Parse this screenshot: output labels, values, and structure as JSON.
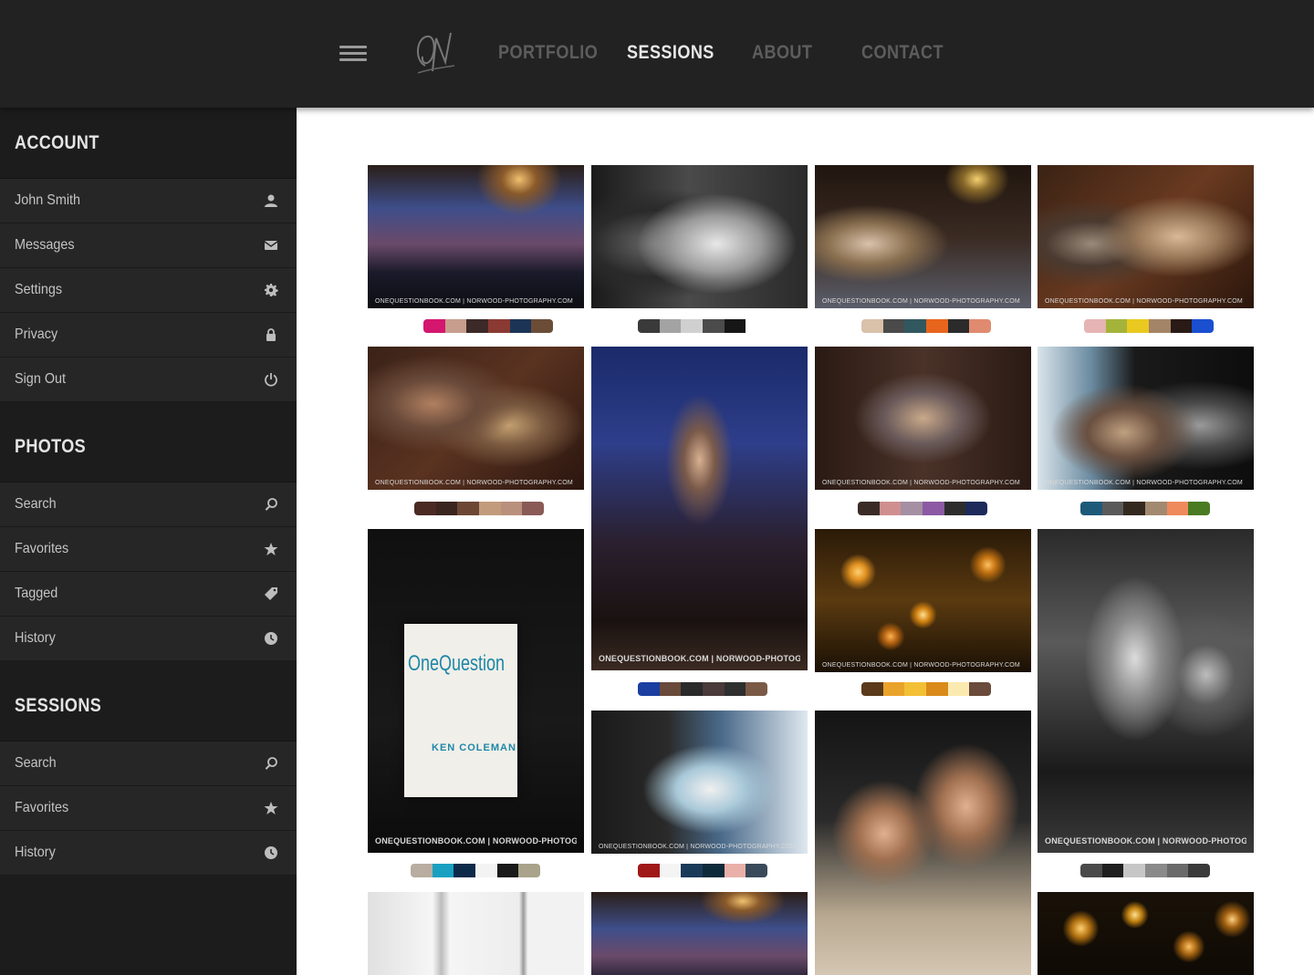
{
  "nav": {
    "logo_text": "ON",
    "items": [
      "PORTFOLIO",
      "SESSIONS",
      "ABOUT",
      "CONTACT"
    ],
    "active": "SESSIONS"
  },
  "sidebar": {
    "account": {
      "title": "ACCOUNT",
      "items": [
        {
          "label": "John Smith",
          "icon": "user-icon"
        },
        {
          "label": "Messages",
          "icon": "envelope-icon"
        },
        {
          "label": "Settings",
          "icon": "gear-icon"
        },
        {
          "label": "Privacy",
          "icon": "lock-icon"
        },
        {
          "label": "Sign Out",
          "icon": "power-icon"
        }
      ]
    },
    "photos": {
      "title": "PHOTOS",
      "items": [
        {
          "label": "Search",
          "icon": "search-icon"
        },
        {
          "label": "Favorites",
          "icon": "star-icon"
        },
        {
          "label": "Tagged",
          "icon": "tag-icon"
        },
        {
          "label": "History",
          "icon": "clock-icon"
        }
      ]
    },
    "sessions": {
      "title": "SESSIONS",
      "items": [
        {
          "label": "Search",
          "icon": "search-icon"
        },
        {
          "label": "Favorites",
          "icon": "star-icon"
        },
        {
          "label": "History",
          "icon": "clock-icon"
        }
      ]
    }
  },
  "gallery": {
    "watermark": "ONEQUESTIONBOOK.COM | NORWOOD-PHOTOGRAPHY.COM",
    "book_title": "OneQuestion",
    "book_author": "KEN COLEMAN",
    "palettes": [
      [
        "#d4166f",
        "#c79e8e",
        "#3c2a28",
        "#8b3a33",
        "#1c3557",
        "#6b4d37"
      ],
      [
        "#3a3a3a",
        "#a3a3a3",
        "#d0d0d0",
        "#4b4b4b",
        "#161616",
        "#ffffff"
      ],
      [
        "#d9c1aa",
        "#4a4a4a",
        "#31585f",
        "#e7651d",
        "#2b2b2b",
        "#e08a6f"
      ],
      [
        "#e6b4b4",
        "#a4b33a",
        "#e9c91f",
        "#a48466",
        "#2a1a16",
        "#1a4fd0"
      ],
      [
        "#4a2a22",
        "#3b251f",
        "#6c4734",
        "#c29b7c",
        "#b9907c",
        "#8a5a57"
      ],
      [
        "#3a2b26",
        "#cf8f8f",
        "#a58fa3",
        "#8c59a3",
        "#2d2d2d",
        "#1d2a5a"
      ],
      [
        "#1d5a7a",
        "#5a5a5a",
        "#33291f",
        "#a28a70",
        "#ef8a5c",
        "#4a7a22"
      ],
      [
        "#1a3fa0",
        "#6a4a3a",
        "#2a2a2a",
        "#4a3a3a",
        "#2f2f2f",
        "#7a5a47"
      ],
      [
        "#5a3a1a",
        "#e9a32a",
        "#f3c035",
        "#d98a1a",
        "#fbeab0",
        "#6a4a3a"
      ],
      [
        "#b8ada0",
        "#1aa0c0",
        "#0d2a4a",
        "#f3f3f3",
        "#1a1a1a",
        "#a8a38a"
      ],
      [
        "#a01818",
        "#f4f4f4",
        "#1a3a5a",
        "#0d2a3a",
        "#e8b0a8",
        "#3a4a5a"
      ],
      [
        "#4a4a4a",
        "#1f1f1f",
        "#c6c6c6",
        "#8a8a8a",
        "#6a6a6a",
        "#3a3a3a"
      ]
    ]
  }
}
